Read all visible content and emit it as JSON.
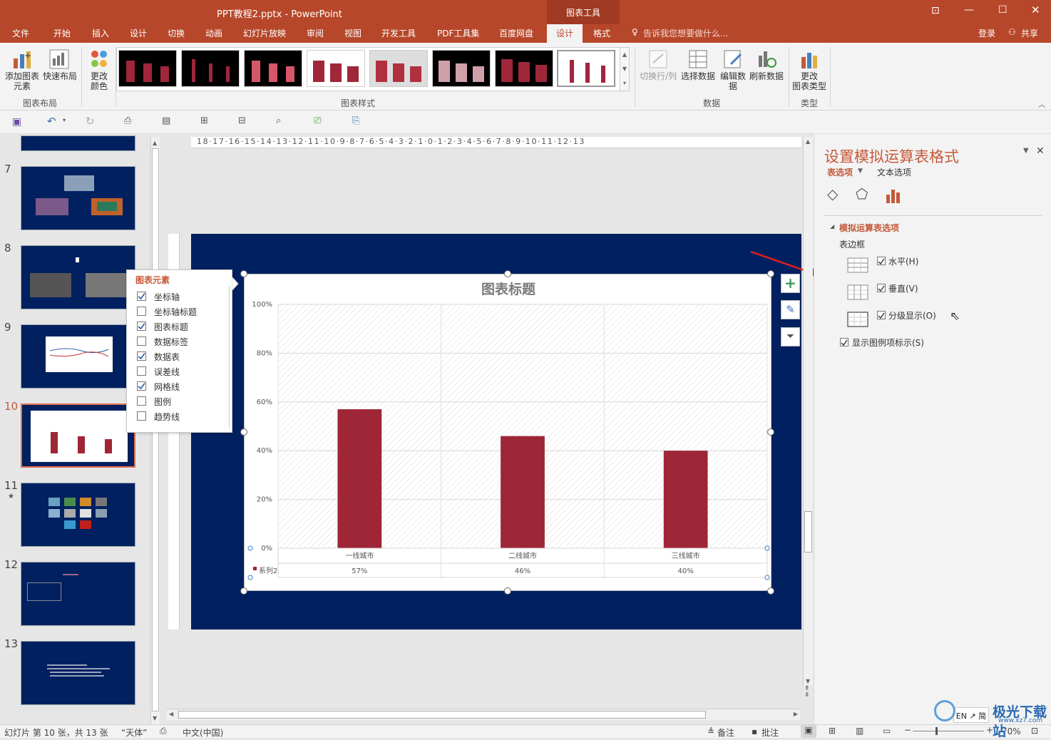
{
  "window": {
    "title": "PPT教程2.pptx - PowerPoint",
    "context_tool": "图表工具",
    "login": "登录",
    "share": "共享"
  },
  "tabs": [
    "文件",
    "开始",
    "插入",
    "设计",
    "切换",
    "动画",
    "幻灯片放映",
    "审阅",
    "视图",
    "开发工具",
    "PDF工具集",
    "百度网盘",
    "设计",
    "格式"
  ],
  "tell_me": "告诉我您想要做什么...",
  "ribbon": {
    "add_element": "添加图表\n元素",
    "quick_layout": "快速布局",
    "change_color": "更改\n颜色",
    "group_layout": "图表布局",
    "group_styles": "图表样式",
    "switch_rowcol": "切换行/列",
    "select_data": "选择数据",
    "edit_data": "编辑数\n据",
    "refresh_data": "刷新数据",
    "group_data": "数据",
    "change_type": "更改\n图表类型",
    "group_type": "类型"
  },
  "slides": [
    {
      "num": "7"
    },
    {
      "num": "8"
    },
    {
      "num": "9"
    },
    {
      "num": "10"
    },
    {
      "num": "11"
    },
    {
      "num": "12"
    },
    {
      "num": "13"
    }
  ],
  "ruler_h": "18·17·16·15·14·13·12·11·10·9·8·7·6·5·4·3·2·1·0·1·2·3·4·5·6·7·8·9·10·11·12·13",
  "chart_popup": {
    "title": "图表元素",
    "items": [
      {
        "label": "坐标轴",
        "checked": true
      },
      {
        "label": "坐标轴标题",
        "checked": false
      },
      {
        "label": "图表标题",
        "checked": true
      },
      {
        "label": "数据标签",
        "checked": false
      },
      {
        "label": "数据表",
        "checked": true
      },
      {
        "label": "误差线",
        "checked": false
      },
      {
        "label": "网格线",
        "checked": true
      },
      {
        "label": "图例",
        "checked": false
      },
      {
        "label": "趋势线",
        "checked": false
      }
    ]
  },
  "chart_data": {
    "type": "bar",
    "title": "图表标题",
    "categories": [
      "一线城市",
      "二线城市",
      "三线城市"
    ],
    "series": [
      {
        "name": "系列2",
        "values": [
          57,
          46,
          40
        ]
      }
    ],
    "data_table_values": [
      "57%",
      "46%",
      "40%"
    ],
    "yticks": [
      "0%",
      "20%",
      "40%",
      "60%",
      "80%",
      "100%"
    ],
    "ylim": [
      0,
      100
    ],
    "grid": true,
    "bar_color": "#9e2636"
  },
  "format_pane": {
    "title": "设置模拟运算表格式",
    "tab_table": "表选项",
    "tab_text": "文本选项",
    "section": "模拟运算表选项",
    "border_label": "表边框",
    "horizontal": "水平(H)",
    "vertical": "垂直(V)",
    "outline": "分级显示(O)",
    "show_legend": "显示图例项标示(S)"
  },
  "status": {
    "slide_info": "幻灯片 第 10 张，共 13 张",
    "theme": "“天体”",
    "language": "中文(中国)",
    "notes": "备注",
    "comments": "批注",
    "zoom": "70%",
    "ime": "EN ↗ 简"
  },
  "watermark": {
    "text": "极光下载站",
    "url": "www.xz7.com"
  },
  "colors": {
    "accent": "#b7472a",
    "slide_bg": "#002060"
  }
}
